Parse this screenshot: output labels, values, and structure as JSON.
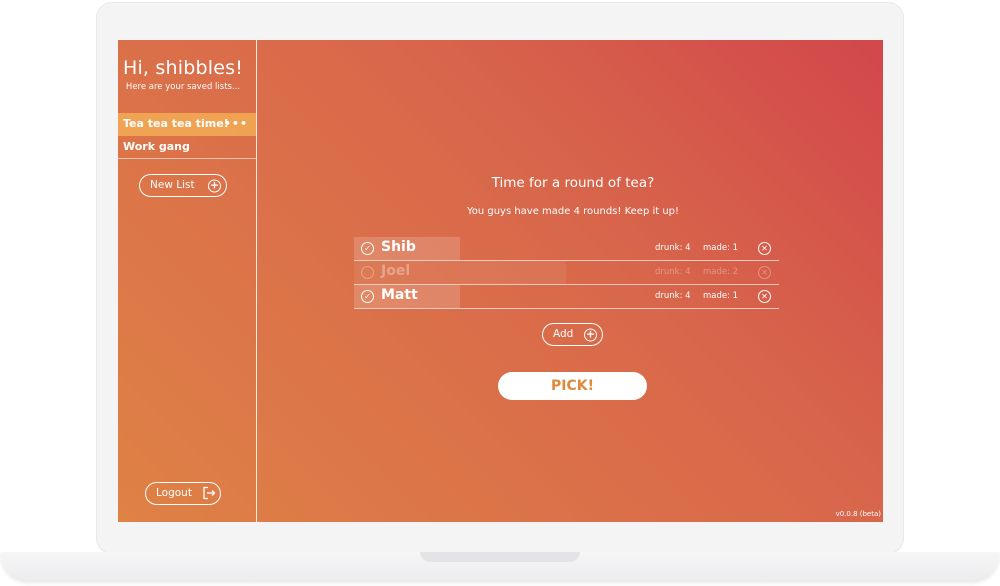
{
  "sidebar": {
    "greeting": "Hi, shibbles!",
    "subtitle": "Here are your saved lists...",
    "lists": [
      {
        "label": "Tea tea tea time!",
        "active": true,
        "menu": "•••"
      },
      {
        "label": "Work gang",
        "active": false
      }
    ],
    "new_list_label": "New List",
    "logout_label": "Logout"
  },
  "main": {
    "title": "Time for a round of tea?",
    "subtitle": "You guys have made 4 rounds! Keep it up!",
    "people": [
      {
        "name": "Shib",
        "drunk": "drunk: 4",
        "made": "made: 1",
        "selected": true
      },
      {
        "name": "Joel",
        "drunk": "drunk: 4",
        "made": "made: 2",
        "selected": false
      },
      {
        "name": "Matt",
        "drunk": "drunk: 4",
        "made": "made: 1",
        "selected": true
      }
    ],
    "add_label": "Add",
    "pick_label": "PICK!"
  },
  "version": "v0.0.8 (beta)",
  "colors": {
    "gradient_top_right": "#d2474b",
    "gradient_bottom_left": "#df8246",
    "active_list": "#f3ab55",
    "pick_text": "#e0893d"
  },
  "icons": {
    "check": "check-circle-icon",
    "remove": "close-circle-icon",
    "add": "plus-circle-icon",
    "logout": "logout-icon"
  }
}
